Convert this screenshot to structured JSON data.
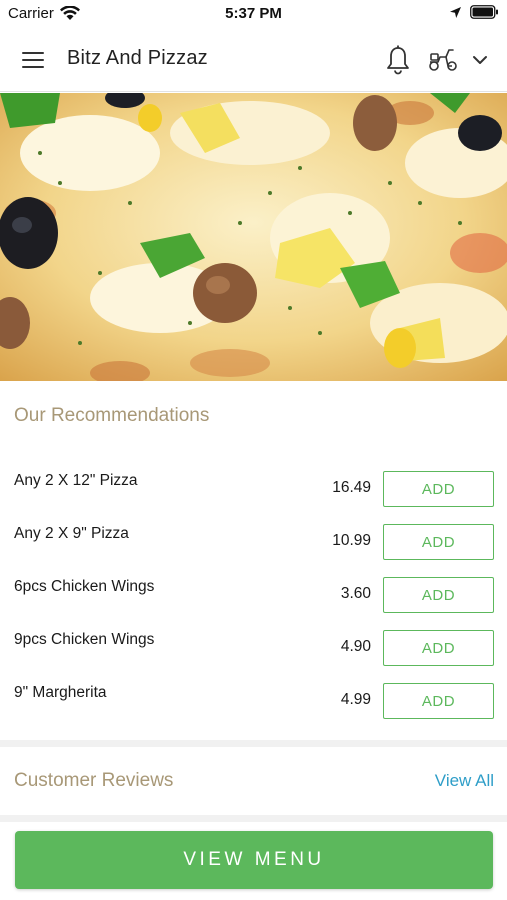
{
  "status_bar": {
    "carrier": "Carrier",
    "time": "5:37 PM"
  },
  "header": {
    "title": "Bitz And Pizzaz",
    "icons": [
      "menu-icon",
      "bell-icon",
      "scooter-icon",
      "chevron-down-icon"
    ]
  },
  "recommendations": {
    "title": "Our Recommendations",
    "items": [
      {
        "name": "Any 2 X 12\" Pizza",
        "price": "16.49",
        "button": "ADD"
      },
      {
        "name": "Any 2 X 9\" Pizza",
        "price": "10.99",
        "button": "ADD"
      },
      {
        "name": "6pcs Chicken Wings",
        "price": "3.60",
        "button": "ADD"
      },
      {
        "name": "9pcs Chicken Wings",
        "price": "4.90",
        "button": "ADD"
      },
      {
        "name": "9\" Margherita",
        "price": "4.99",
        "button": "ADD"
      }
    ]
  },
  "reviews": {
    "title": "Customer Reviews",
    "view_all": "View All"
  },
  "footer": {
    "button": "VIEW MENU"
  },
  "colors": {
    "accent_green": "#5cb85c",
    "section_title": "#a89877",
    "link_blue": "#2f9ec8"
  }
}
